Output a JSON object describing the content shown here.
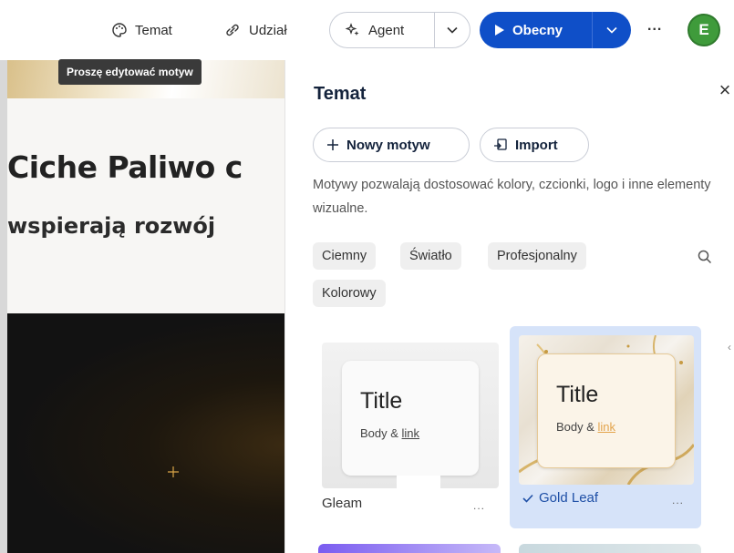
{
  "toolbar": {
    "theme_label": "Temat",
    "share_label": "Udział",
    "agent_label": "Agent",
    "present_label": "Obecny",
    "more_label": "...",
    "avatar_initial": "E"
  },
  "tooltip": "Proszę edytować motyw",
  "slide": {
    "title": "Ciche Paliwo c",
    "subtitle": "wspierają rozwój"
  },
  "panel": {
    "title": "Temat",
    "close_label": "×",
    "new_theme_label": "Nowy motyw",
    "import_label": "Import",
    "description": "Motywy pozwalają dostosować kolory, czcionki, logo i inne elementy wizualne.",
    "filters": [
      "Ciemny",
      "Światło",
      "Profesjonalny",
      "Kolorowy"
    ]
  },
  "themes": [
    {
      "name": "Gleam",
      "preview_title": "Title",
      "preview_body": "Body & ",
      "preview_link": "link",
      "selected": false,
      "more": "..."
    },
    {
      "name": "Gold Leaf",
      "preview_title": "Title",
      "preview_body": "Body & ",
      "preview_link": "link",
      "selected": true,
      "more": "..."
    }
  ],
  "colors": {
    "accent": "#0f4fc8",
    "selected_card_bg": "#d6e3f9",
    "avatar": "#3f9b3b",
    "gold_link": "#e3a44c"
  }
}
